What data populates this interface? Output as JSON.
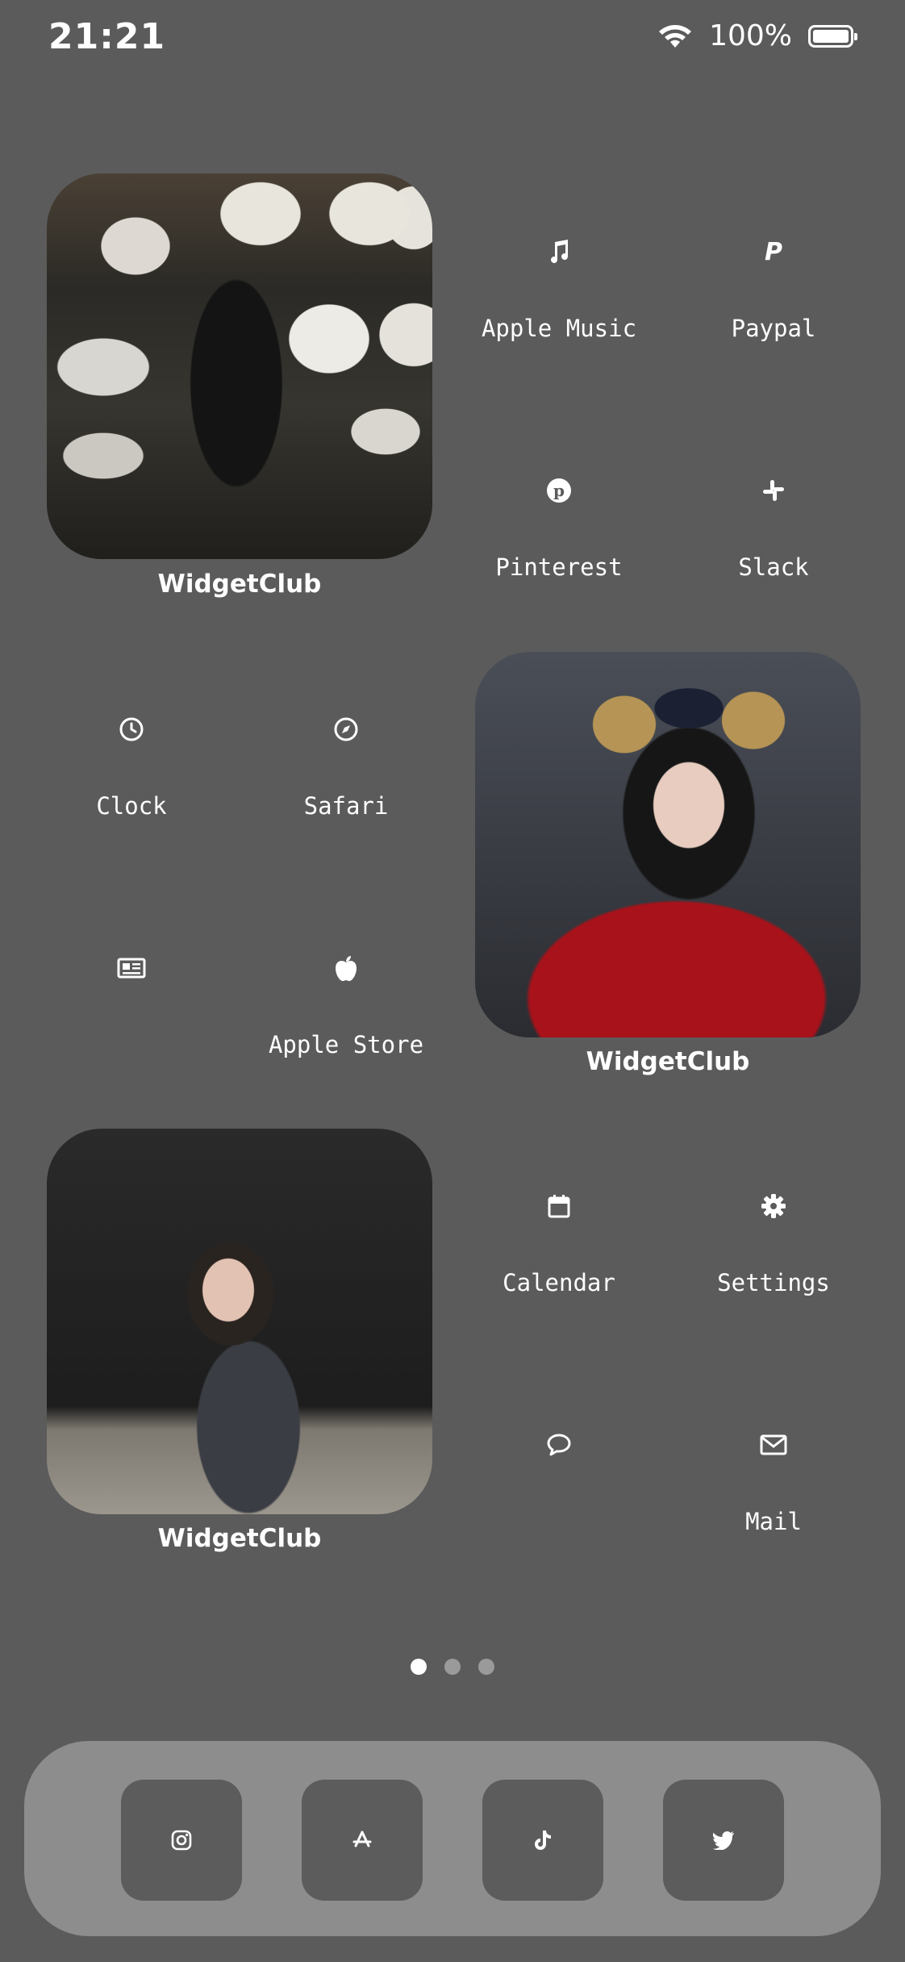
{
  "status_bar": {
    "time": "21:21",
    "battery_percent": "100%"
  },
  "widgets": [
    {
      "label": "WidgetClub",
      "photo": "person-in-plush-toy-shop"
    },
    {
      "label": "WidgetClub",
      "photo": "girl-in-red-sweater-with-mouse-ears"
    },
    {
      "label": "WidgetClub",
      "photo": "girl-crouching-against-dark-wall"
    }
  ],
  "apps": {
    "apple_music": "Apple Music",
    "paypal": "Paypal",
    "pinterest": "Pinterest",
    "slack": "Slack",
    "clock": "Clock",
    "safari": "Safari",
    "news": "",
    "apple_store": "Apple Store",
    "calendar": "Calendar",
    "settings": "Settings",
    "messages": "",
    "mail": "Mail"
  },
  "page_indicator": {
    "count": 3,
    "active": 1
  },
  "dock": [
    {
      "icon": "instagram-icon"
    },
    {
      "icon": "app-store-icon"
    },
    {
      "icon": "tiktok-icon"
    },
    {
      "icon": "twitter-icon"
    }
  ],
  "colors": {
    "background": "#5b5b5b",
    "dock": "#8d8d8d",
    "dock_tile": "#5c5c5c"
  }
}
